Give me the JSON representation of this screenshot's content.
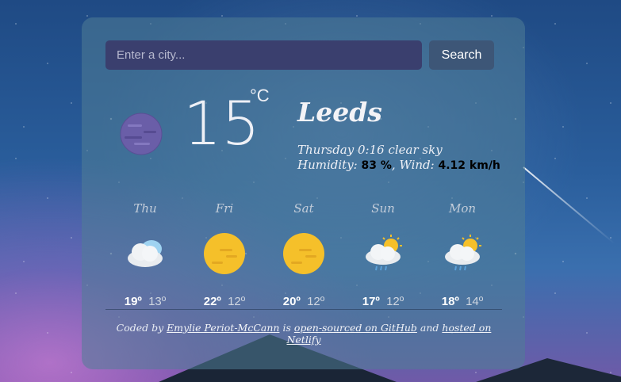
{
  "search": {
    "placeholder": "Enter a city...",
    "button_label": "Search"
  },
  "current": {
    "temperature": "15",
    "unit": "°C",
    "city": "Leeds",
    "day_time": "Thursday 0:16",
    "description": "clear sky",
    "humidity_label": "Humidity:",
    "humidity_value": "83 %",
    "wind_label": "Wind:",
    "wind_value": "4.12 km/h",
    "icon": "moon-icon"
  },
  "forecast": [
    {
      "day": "Thu",
      "icon": "cloud-icon",
      "high": "19º",
      "low": "13º"
    },
    {
      "day": "Fri",
      "icon": "sun-icon",
      "high": "22º",
      "low": "12º"
    },
    {
      "day": "Sat",
      "icon": "sun-icon",
      "high": "20º",
      "low": "12º"
    },
    {
      "day": "Sun",
      "icon": "sun-cloud-rain-icon",
      "high": "17º",
      "low": "12º"
    },
    {
      "day": "Mon",
      "icon": "sun-cloud-rain-icon",
      "high": "18º",
      "low": "14º"
    }
  ],
  "footer": {
    "coded_by": "Coded by",
    "author_link": "Emylie Periot-McCann",
    "is_text": "is",
    "github_link": "open-sourced on GitHub",
    "and_text": "and",
    "netlify_link": "hosted on Netlify"
  },
  "colors": {
    "input_bg": "#3a3f6e",
    "button_bg": "#3d5677",
    "sun": "#f5c02a",
    "moon": "#6a5ea8"
  }
}
